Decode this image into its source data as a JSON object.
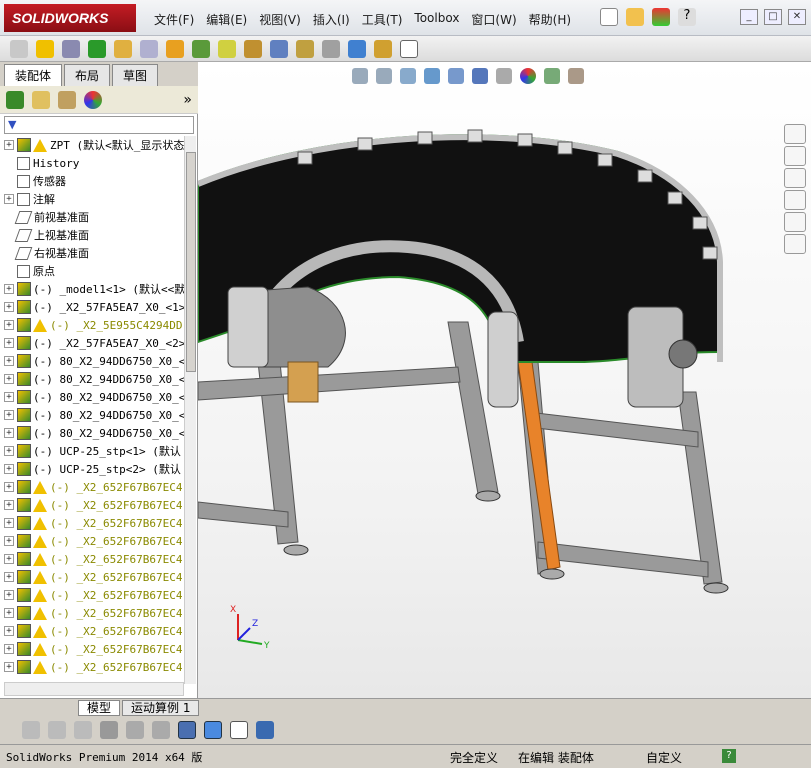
{
  "app": {
    "logo_text": "SOLIDWORKS"
  },
  "menu": [
    "文件(F)",
    "编辑(E)",
    "视图(V)",
    "插入(I)",
    "工具(T)",
    "Toolbox",
    "窗口(W)",
    "帮助(H)"
  ],
  "panel_tabs": [
    "装配体",
    "布局",
    "草图"
  ],
  "tree": [
    {
      "label": "ZPT  (默认<默认_显示状态",
      "icon": "assembly-icon",
      "warn": true,
      "expand": true,
      "root": true
    },
    {
      "label": "History",
      "icon": "history-icon",
      "warn": false,
      "expand": false
    },
    {
      "label": "传感器",
      "icon": "sensor-icon",
      "warn": false,
      "expand": false
    },
    {
      "label": "注解",
      "icon": "annotation-icon",
      "warn": false,
      "expand": true
    },
    {
      "label": "前视基准面",
      "icon": "plane-icon",
      "warn": false,
      "expand": false
    },
    {
      "label": "上视基准面",
      "icon": "plane-icon",
      "warn": false,
      "expand": false
    },
    {
      "label": "右视基准面",
      "icon": "plane-icon",
      "warn": false,
      "expand": false
    },
    {
      "label": "原点",
      "icon": "origin-icon",
      "warn": false,
      "expand": false
    },
    {
      "label": "(-) _model1<1> (默认<<默",
      "icon": "part-icon",
      "warn": false,
      "expand": true
    },
    {
      "label": "(-) _X2_57FA5EA7_X0_<1>",
      "icon": "part-icon",
      "warn": false,
      "expand": true
    },
    {
      "label": "(-) _X2_5E955C4294DD",
      "icon": "part-icon",
      "warn": true,
      "expand": true
    },
    {
      "label": "(-) _X2_57FA5EA7_X0_<2>",
      "icon": "part-icon",
      "warn": false,
      "expand": true
    },
    {
      "label": "(-) 80_X2_94DD6750_X0_<",
      "icon": "part-icon",
      "warn": false,
      "expand": true
    },
    {
      "label": "(-) 80_X2_94DD6750_X0_<",
      "icon": "part-icon",
      "warn": false,
      "expand": true
    },
    {
      "label": "(-) 80_X2_94DD6750_X0_<",
      "icon": "part-icon",
      "warn": false,
      "expand": true
    },
    {
      "label": "(-) 80_X2_94DD6750_X0_<",
      "icon": "part-icon",
      "warn": false,
      "expand": true
    },
    {
      "label": "(-) 80_X2_94DD6750_X0_<",
      "icon": "part-icon",
      "warn": false,
      "expand": true
    },
    {
      "label": "(-) UCP-25_stp<1> (默认",
      "icon": "part-icon",
      "warn": false,
      "expand": true
    },
    {
      "label": "(-) UCP-25_stp<2> (默认",
      "icon": "part-icon",
      "warn": false,
      "expand": true
    },
    {
      "label": "(-) _X2_652F67B67EC4",
      "icon": "part-icon",
      "warn": true,
      "expand": true
    },
    {
      "label": "(-) _X2_652F67B67EC4",
      "icon": "part-icon",
      "warn": true,
      "expand": true
    },
    {
      "label": "(-) _X2_652F67B67EC4",
      "icon": "part-icon",
      "warn": true,
      "expand": true
    },
    {
      "label": "(-) _X2_652F67B67EC4",
      "icon": "part-icon",
      "warn": true,
      "expand": true
    },
    {
      "label": "(-) _X2_652F67B67EC4",
      "icon": "part-icon",
      "warn": true,
      "expand": true
    },
    {
      "label": "(-) _X2_652F67B67EC4",
      "icon": "part-icon",
      "warn": true,
      "expand": true
    },
    {
      "label": "(-) _X2_652F67B67EC4",
      "icon": "part-icon",
      "warn": true,
      "expand": true
    },
    {
      "label": "(-) _X2_652F67B67EC4",
      "icon": "part-icon",
      "warn": true,
      "expand": true
    },
    {
      "label": "(-) _X2_652F67B67EC4",
      "icon": "part-icon",
      "warn": true,
      "expand": true
    },
    {
      "label": "(-) _X2_652F67B67EC4",
      "icon": "part-icon",
      "warn": true,
      "expand": true
    },
    {
      "label": "(-) _X2_652F67B67EC4",
      "icon": "part-icon",
      "warn": true,
      "expand": true
    }
  ],
  "bottom_tabs": [
    "模型",
    "运动算例 1"
  ],
  "triad": {
    "x": "X",
    "y": "Y",
    "z": "Z"
  },
  "status": {
    "product": "SolidWorks Premium 2014 x64 版",
    "constraint": "完全定义",
    "mode": "在编辑 装配体",
    "units": "自定义"
  },
  "colors": {
    "accent": "#c41c24",
    "belt": "#111111",
    "frame": "#a9a9a9",
    "warn": "#f0c000"
  }
}
